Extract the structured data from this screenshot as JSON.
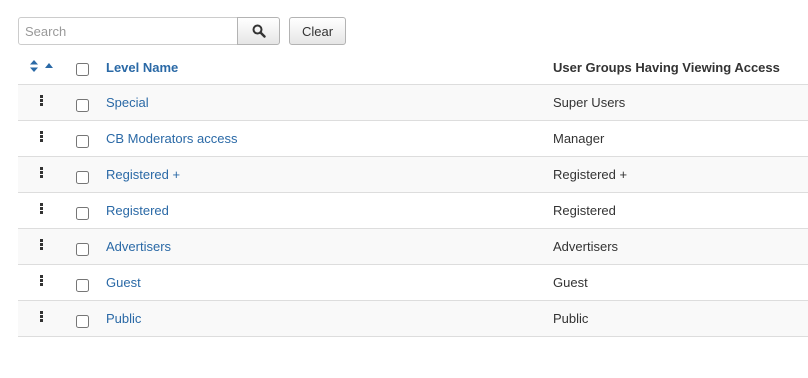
{
  "search": {
    "placeholder": "Search",
    "value": ""
  },
  "toolbar": {
    "clear_label": "Clear"
  },
  "columns": {
    "level_name": "Level Name",
    "user_groups": "User Groups Having Viewing Access"
  },
  "rows": [
    {
      "level_name": "Special",
      "user_groups": "Super Users"
    },
    {
      "level_name": "CB Moderators access",
      "user_groups": "Manager"
    },
    {
      "level_name": "Registered +",
      "user_groups": "Registered +"
    },
    {
      "level_name": "Registered",
      "user_groups": "Registered"
    },
    {
      "level_name": "Advertisers",
      "user_groups": "Advertisers"
    },
    {
      "level_name": "Guest",
      "user_groups": "Guest"
    },
    {
      "level_name": "Public",
      "user_groups": "Public"
    }
  ],
  "colors": {
    "link": "#2a69a6",
    "stripe": "#f9f9f9",
    "border": "#dddddd"
  },
  "icons": {
    "search": "search-icon",
    "sort": "sort-icon",
    "drag": "drag-handle-icon"
  }
}
